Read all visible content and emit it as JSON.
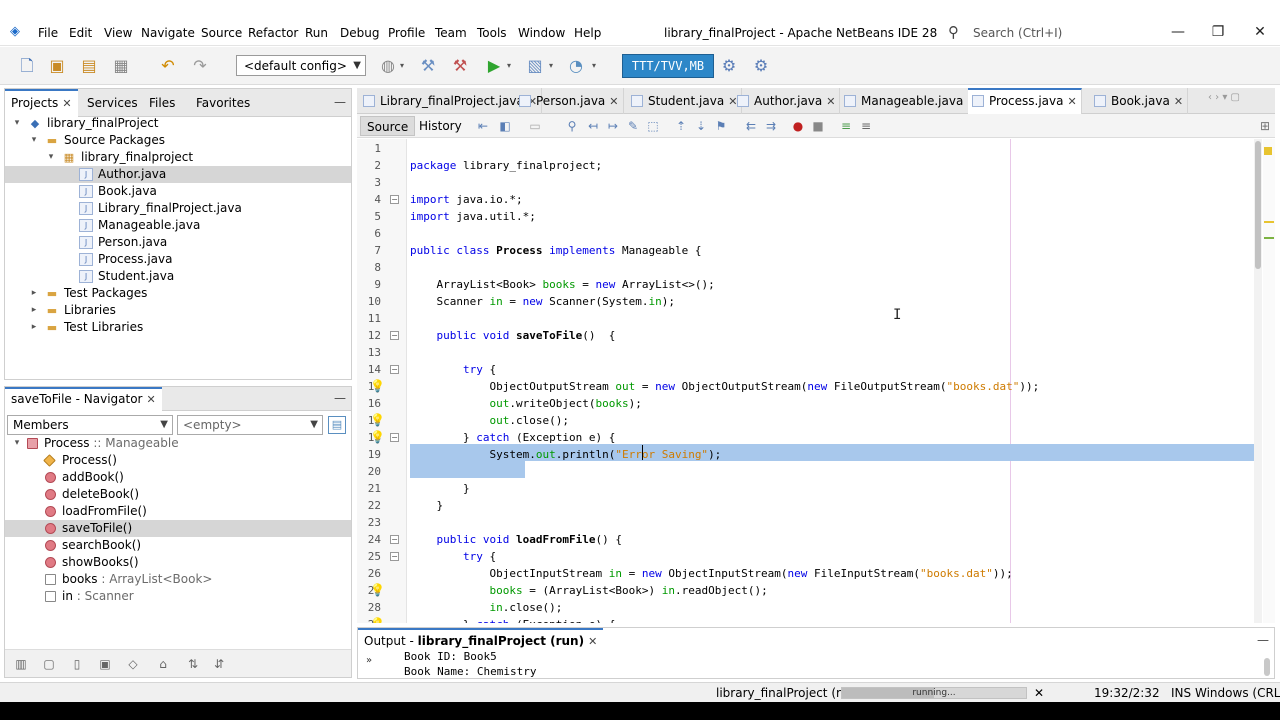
{
  "app": {
    "window_title": "library_finalProject - Apache NetBeans IDE 28",
    "menu": [
      "File",
      "Edit",
      "View",
      "Navigate",
      "Source",
      "Refactor",
      "Run",
      "Debug",
      "Profile",
      "Team",
      "Tools",
      "Window",
      "Help"
    ],
    "search_placeholder": "Search (Ctrl+I)"
  },
  "toolbar": {
    "config_value": "<default config>",
    "memory": "TTT/TVV,MB"
  },
  "projects_panel": {
    "tabs": [
      "Projects",
      "Services",
      "Files",
      "Favorites"
    ],
    "tree": [
      {
        "label": "library_finalProject",
        "level": 0,
        "icon": "project-icon",
        "expanded": true
      },
      {
        "label": "Source Packages",
        "level": 1,
        "icon": "folder-icon",
        "expanded": true
      },
      {
        "label": "library_finalproject",
        "level": 2,
        "icon": "package-icon",
        "expanded": true
      },
      {
        "label": "Author.java",
        "level": 3,
        "icon": "java-file-icon",
        "selected": true
      },
      {
        "label": "Book.java",
        "level": 3,
        "icon": "java-file-icon"
      },
      {
        "label": "Library_finalProject.java",
        "level": 3,
        "icon": "java-file-icon"
      },
      {
        "label": "Manageable.java",
        "level": 3,
        "icon": "java-file-icon"
      },
      {
        "label": "Person.java",
        "level": 3,
        "icon": "java-file-icon"
      },
      {
        "label": "Process.java",
        "level": 3,
        "icon": "java-file-icon"
      },
      {
        "label": "Student.java",
        "level": 3,
        "icon": "java-file-icon"
      },
      {
        "label": "Test Packages",
        "level": 1,
        "icon": "folder-icon",
        "expanded": false
      },
      {
        "label": "Libraries",
        "level": 1,
        "icon": "folder-icon",
        "expanded": false
      },
      {
        "label": "Test Libraries",
        "level": 1,
        "icon": "folder-icon",
        "expanded": false
      }
    ]
  },
  "navigator": {
    "title": "saveToFile - Navigator",
    "filter_value": "Members",
    "filter2_value": "<empty>",
    "members": [
      {
        "name": "Process",
        "suffix": " :: Manageable",
        "kind": "class"
      },
      {
        "name": "Process()",
        "suffix": "",
        "kind": "constructor"
      },
      {
        "name": "addBook()",
        "suffix": "",
        "kind": "method"
      },
      {
        "name": "deleteBook()",
        "suffix": "",
        "kind": "method"
      },
      {
        "name": "loadFromFile()",
        "suffix": "",
        "kind": "method"
      },
      {
        "name": "saveToFile()",
        "suffix": "",
        "kind": "method",
        "selected": true
      },
      {
        "name": "searchBook()",
        "suffix": "",
        "kind": "method"
      },
      {
        "name": "showBooks()",
        "suffix": "",
        "kind": "method"
      },
      {
        "name": "books",
        "suffix": " : ArrayList<Book>",
        "kind": "field"
      },
      {
        "name": "in",
        "suffix": " : Scanner",
        "kind": "field"
      }
    ]
  },
  "editor": {
    "tabs": [
      {
        "label": "Library_finalProject.java"
      },
      {
        "label": "Person.java"
      },
      {
        "label": "Student.java"
      },
      {
        "label": "Author.java"
      },
      {
        "label": "Manageable.java"
      },
      {
        "label": "Process.java",
        "active": true
      },
      {
        "label": "Book.java"
      }
    ],
    "view_source": "Source",
    "view_history": "History",
    "line_numbers": [
      "1",
      "2",
      "3",
      "4",
      "5",
      "6",
      "7",
      "8",
      "9",
      "10",
      "11",
      "12",
      "13",
      "14",
      "15",
      "16",
      "17",
      "18",
      "19",
      "20",
      "21",
      "22",
      "23",
      "24",
      "25",
      "26",
      "27",
      "28",
      "29"
    ],
    "code": [
      "",
      "package library_finalproject;",
      "",
      "import java.io.*;",
      "import java.util.*;",
      "",
      "public class Process implements Manageable {",
      "",
      "    ArrayList<Book> books = new ArrayList<>();",
      "    Scanner in = new Scanner(System.in);",
      "",
      "    public void saveToFile()  {",
      "",
      "        try {",
      "            ObjectOutputStream out = new ObjectOutputStream(new FileOutputStream(\"books.dat\"));",
      "            out.writeObject(books);",
      "            out.close();",
      "        } catch (Exception e) {",
      "            System.out.println(\"Error Saving\");",
      "",
      "        }",
      "    }",
      "",
      "    public void loadFromFile() {",
      "        try {",
      "            ObjectInputStream in = new ObjectInputStream(new FileInputStream(\"books.dat\"));",
      "            books = (ArrayList<Book>) in.readObject();",
      "            in.close();",
      "        } catch (Exception e) {"
    ]
  },
  "output": {
    "tab_prefix": "Output - ",
    "tab_project": "library_finalProject (run)",
    "lines": [
      "Book ID: Book5",
      "Book Name: Chemistry"
    ]
  },
  "statusbar": {
    "run_label": "library_finalProject (run)",
    "progress_text": "running...",
    "progress": 0.5,
    "position": "19:32/2:32",
    "insert_mode": "INS",
    "line_endings": "Windows (CRLF)"
  }
}
